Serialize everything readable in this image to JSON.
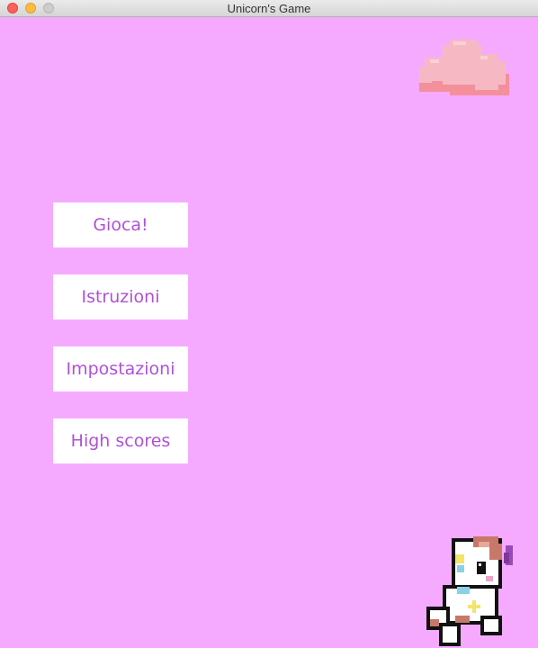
{
  "window": {
    "title": "Unicorn's Game"
  },
  "menu": {
    "play_label": "Gioca!",
    "instructions_label": "Istruzioni",
    "settings_label": "Impostazioni",
    "high_scores_label": "High scores"
  },
  "colors": {
    "background": "#f5aaff",
    "button_bg": "#ffffff",
    "button_text": "#b050d8"
  },
  "decorations": {
    "cloud": "cloud-icon",
    "unicorn": "unicorn-sprite"
  }
}
